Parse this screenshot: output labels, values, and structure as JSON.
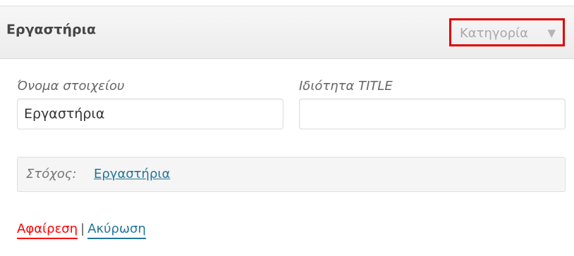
{
  "menu_item": {
    "title": "Εργαστήρια",
    "type_label": "Κατηγορία",
    "type_arrow": "▼",
    "highlight_color": "#e00000"
  },
  "fields": {
    "nav_label": {
      "label": "Όνομα στοιχείου",
      "value": "Εργαστήρια"
    },
    "title_attribute": {
      "label": "Ιδιότητα TITLE",
      "value": ""
    }
  },
  "original": {
    "label": "Στόχος:",
    "link_text": "Εργαστήρια"
  },
  "actions": {
    "remove": "Αφαίρεση",
    "separator": "|",
    "cancel": "Ακύρωση"
  },
  "colors": {
    "link": "#21759b",
    "remove": "#ff0000"
  }
}
